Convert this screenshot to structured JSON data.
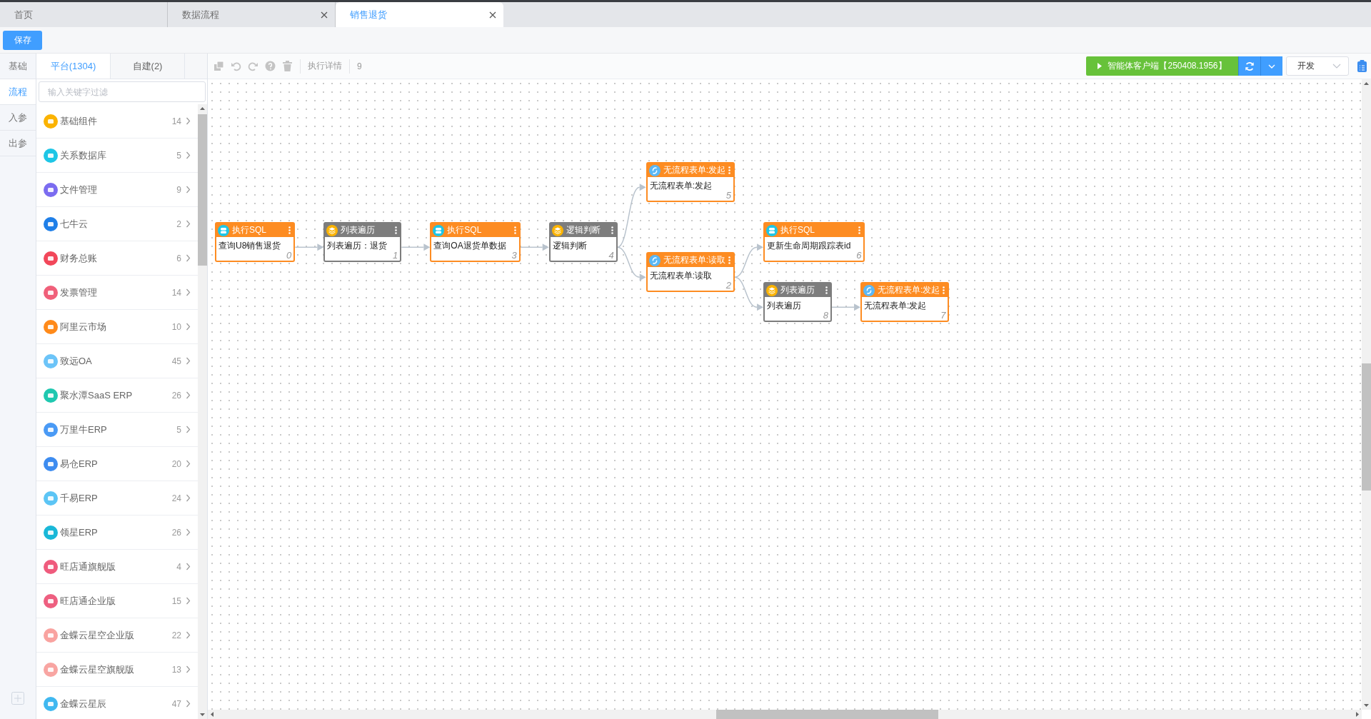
{
  "tabs": [
    {
      "label": "首页",
      "closable": false,
      "selected": false
    },
    {
      "label": "数据流程",
      "closable": true,
      "selected": false
    },
    {
      "label": "销售退货",
      "closable": true,
      "selected": true
    }
  ],
  "save_button": "保存",
  "rail": [
    {
      "label": "基础",
      "selected": false
    },
    {
      "label": "流程",
      "selected": true
    },
    {
      "label": "入参",
      "selected": false
    },
    {
      "label": "出参",
      "selected": false
    }
  ],
  "panel": {
    "tabs": [
      {
        "label": "平台(1304)",
        "selected": true
      },
      {
        "label": "自建(2)",
        "selected": false
      }
    ],
    "search": {
      "placeholder": "输入关键字过滤"
    },
    "items": [
      {
        "label": "基础组件",
        "count": "14",
        "color": "#fbb300"
      },
      {
        "label": "关系数据库",
        "count": "5",
        "color": "#1ec6e6"
      },
      {
        "label": "文件管理",
        "count": "9",
        "color": "#7b6cf0"
      },
      {
        "label": "七牛云",
        "count": "2",
        "color": "#1f7fe8"
      },
      {
        "label": "财务总账",
        "count": "6",
        "color": "#f2475a"
      },
      {
        "label": "发票管理",
        "count": "14",
        "color": "#f0607a"
      },
      {
        "label": "阿里云市场",
        "count": "10",
        "color": "#ff8a1a"
      },
      {
        "label": "致远OA",
        "count": "45",
        "color": "#6cc4f8"
      },
      {
        "label": "聚水潭SaaS ERP",
        "count": "26",
        "color": "#1fc8b0"
      },
      {
        "label": "万里牛ERP",
        "count": "5",
        "color": "#4a9af5"
      },
      {
        "label": "易仓ERP",
        "count": "20",
        "color": "#3d8cf0"
      },
      {
        "label": "千易ERP",
        "count": "24",
        "color": "#5cc5f5"
      },
      {
        "label": "领星ERP",
        "count": "26",
        "color": "#1ab8d8"
      },
      {
        "label": "旺店通旗舰版",
        "count": "4",
        "color": "#ef5b7d"
      },
      {
        "label": "旺店通企业版",
        "count": "15",
        "color": "#ee5f80"
      },
      {
        "label": "金蝶云星空企业版",
        "count": "22",
        "color": "#f9a3a0"
      },
      {
        "label": "金蝶云星空旗舰版",
        "count": "13",
        "color": "#f8a5a2"
      },
      {
        "label": "金蝶云星辰",
        "count": "47",
        "color": "#40b8f0"
      }
    ]
  },
  "toolbar": {
    "details": "执行详情",
    "count": "9"
  },
  "run_button": "智能体客户端【250408.1956】",
  "env_select": {
    "value": "开发"
  },
  "flow": {
    "title": "执行SQL",
    "label": "查询U8销售退货",
    "number": "0",
    "kind": "sql",
    "color": "#fd8c22",
    "children": [
      {
        "title": "列表遍历",
        "label": "列表遍历：退货",
        "number": "1",
        "kind": "loop",
        "color": "#7d7d7d",
        "children": [
          {
            "title": "执行SQL",
            "label": "查询OA退货单数据",
            "number": "3",
            "kind": "sql",
            "color": "#fd8c22",
            "children": [
              {
                "title": "逻辑判断",
                "label": "逻辑判断",
                "number": "4",
                "kind": "logic",
                "color": "#7d7d7d",
                "children": [
                  {
                    "title": "无流程表单:发起",
                    "label": "无流程表单:发起",
                    "number": "5",
                    "kind": "form",
                    "color": "#fd8c22"
                  },
                  {
                    "title": "无流程表单:读取",
                    "label": "无流程表单:读取",
                    "number": "2",
                    "kind": "form",
                    "color": "#fd8c22",
                    "children": [
                      {
                        "title": "执行SQL",
                        "label": "更新生命周期跟踪表id",
                        "number": "6",
                        "kind": "sql",
                        "color": "#fd8c22"
                      },
                      {
                        "title": "列表遍历",
                        "label": "列表遍历",
                        "number": "8",
                        "kind": "loop",
                        "color": "#7d7d7d",
                        "children": [
                          {
                            "title": "无流程表单:发起",
                            "label": "无流程表单:发起",
                            "number": "7",
                            "kind": "form",
                            "color": "#fd8c22"
                          }
                        ]
                      }
                    ]
                  }
                ]
              }
            ]
          }
        ]
      }
    ]
  }
}
